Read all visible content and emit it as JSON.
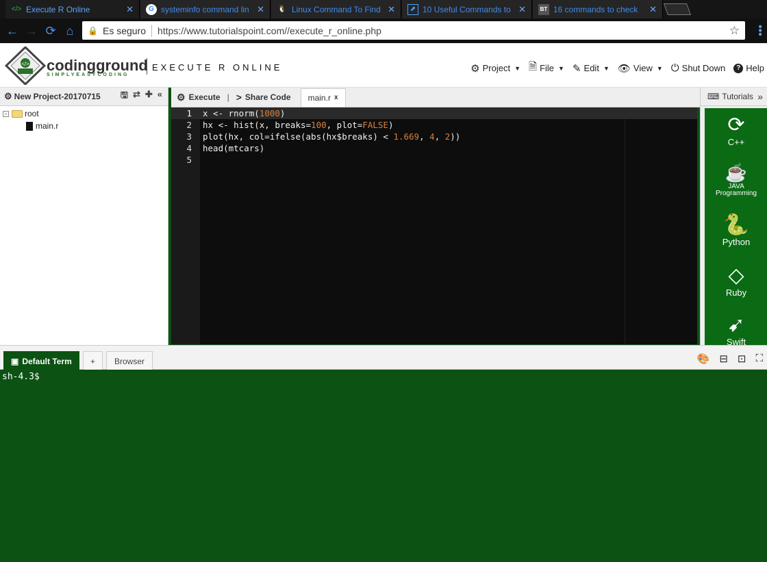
{
  "browser": {
    "tabs": [
      {
        "title": "Execute R Online",
        "favicon": "code-icon",
        "active": true
      },
      {
        "title": "systeminfo command lin",
        "favicon": "google-icon",
        "active": false
      },
      {
        "title": "Linux Command To Find",
        "favicon": "tux-icon",
        "active": false
      },
      {
        "title": "10 Useful Commands to",
        "favicon": "site-icon",
        "active": false
      },
      {
        "title": "16 commands to check",
        "favicon": "bt-icon",
        "active": false
      }
    ],
    "bt_favicon_text": "BT",
    "secure_label": "Es seguro",
    "url": "https://www.tutorialspoint.com//execute_r_online.php"
  },
  "header": {
    "brand": "codingground",
    "tagline": "SIMPLYEASYCODING",
    "subtitle": "EXECUTE R ONLINE",
    "menu": {
      "project": "Project",
      "file": "File",
      "edit": "Edit",
      "view": "View",
      "shutdown": "Shut Down",
      "help": "Help"
    }
  },
  "project": {
    "name": "New Project-20170715",
    "tree": {
      "root": "root",
      "file": "main.r"
    }
  },
  "editor": {
    "execute_label": "Execute",
    "share_label": "Share Code",
    "pipe": "|",
    "file_tab": "main.r",
    "close": "x",
    "line_numbers": [
      "1",
      "2",
      "3",
      "4",
      "5"
    ],
    "lines": [
      "x <- rnorm(1000)",
      "hx <- hist(x, breaks=100, plot=FALSE)",
      "plot(hx, col=ifelse(abs(hx$breaks) < 1.669, 4, 2))",
      "head(mtcars)",
      ""
    ]
  },
  "tutorials": {
    "title": "Tutorials",
    "items": [
      {
        "label": "C++",
        "icon": "cpp-icon"
      },
      {
        "label": "JAVA",
        "sub": "Programming",
        "icon": "java-icon"
      },
      {
        "label": "Python",
        "icon": "python-icon"
      },
      {
        "label": "Ruby",
        "icon": "ruby-icon"
      },
      {
        "label": "Swift",
        "icon": "swift-icon"
      }
    ]
  },
  "terminal": {
    "tabs": {
      "default": "Default Term",
      "add": "+",
      "browser": "Browser"
    },
    "prompt": "sh-4.3$"
  },
  "colors": {
    "terminal_bg": "#0b5213",
    "tutorial_bg": "#0b6a14",
    "editor_bg": "#0d0d0d",
    "link_blue": "#3f8bf3"
  }
}
